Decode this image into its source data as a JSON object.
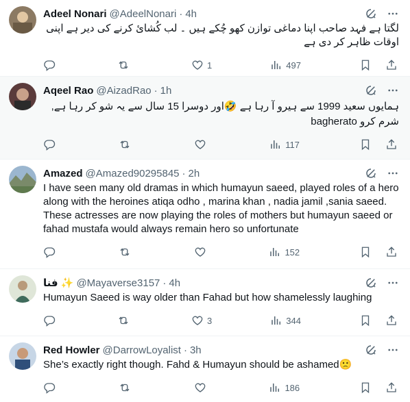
{
  "tweets": [
    {
      "name": "Adeel Nonari",
      "handle": "@AdeelNonari",
      "time": "4h",
      "text": "لگتا ہے فہد صاحب اپنا دماغی توازن کھو چُکے ہیں ۔ لب کُشائ کرنے کی دیر ہے اپنی اوقات ظاہر کر دی ہے",
      "replies": "",
      "retweets": "",
      "likes": "1",
      "views": "497"
    },
    {
      "name": "Aqeel Rao",
      "handle": "@AizadRao",
      "time": "1h",
      "text_line1": "ہمایوں سعید 1999 سے ہیرو آ رہا ہے 🤣اور دوسرا 15 سال سے یہ شو کر رہا ہے,",
      "text_line2": "شرم کرو bagherato",
      "replies": "",
      "retweets": "",
      "likes": "",
      "views": "117"
    },
    {
      "name": "Amazed",
      "handle": "@Amazed90295845",
      "time": "2h",
      "text": "I have seen many old dramas in which humayun saeed, played roles of a hero along with the heroines atiqa odho , marina khan , nadia jamil ,sania saeed. These actresses are now playing the roles of mothers but humayun saeed or fahad mustafa would always remain hero so unfortunate",
      "replies": "",
      "retweets": "",
      "likes": "",
      "views": "152"
    },
    {
      "name": "فنا ✨",
      "handle": "@Mayaverse3157",
      "time": "4h",
      "text": "Humayun Saeed is way older than Fahad but how shamelessly laughing",
      "replies": "",
      "retweets": "",
      "likes": "3",
      "views": "344"
    },
    {
      "name": "Red Howler",
      "handle": "@DarrowLoyalist",
      "time": "3h",
      "text": "She’s exactly right though. Fahd & Humayun should be ashamed🙁",
      "replies": "",
      "retweets": "",
      "likes": "",
      "views": "186"
    }
  ],
  "colors": {
    "text": "#0f1419",
    "secondary": "#536471",
    "border": "#eff3f4",
    "highlight_bg": "#f7f9f9"
  },
  "icons": [
    "grok-icon",
    "more-icon",
    "reply-icon",
    "retweet-icon",
    "like-icon",
    "views-icon",
    "bookmark-icon",
    "share-icon"
  ]
}
